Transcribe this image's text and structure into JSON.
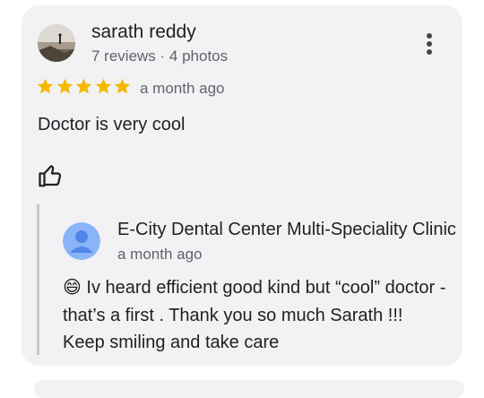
{
  "review": {
    "author": "sarath reddy",
    "author_meta": "7 reviews · 4 photos",
    "rating": 5,
    "star_color": "#f6b800",
    "time": "a month ago",
    "text": "Doctor is very cool",
    "avatar_icon": "landscape-photo-avatar",
    "more_icon": "more-vert-icon",
    "like_icon": "thumb-up-outline-icon"
  },
  "owner_reply": {
    "name": "E-City Dental Center Multi-Speciality Clinic",
    "time": "a month ago",
    "avatar_icon": "person-avatar-icon",
    "avatar_color": "#8ab4f8",
    "emoji": "😄",
    "text": " Iv heard efficient good kind but “cool” doctor - that’s a first . Thank you so much Sarath !!! Keep smiling and take care"
  }
}
